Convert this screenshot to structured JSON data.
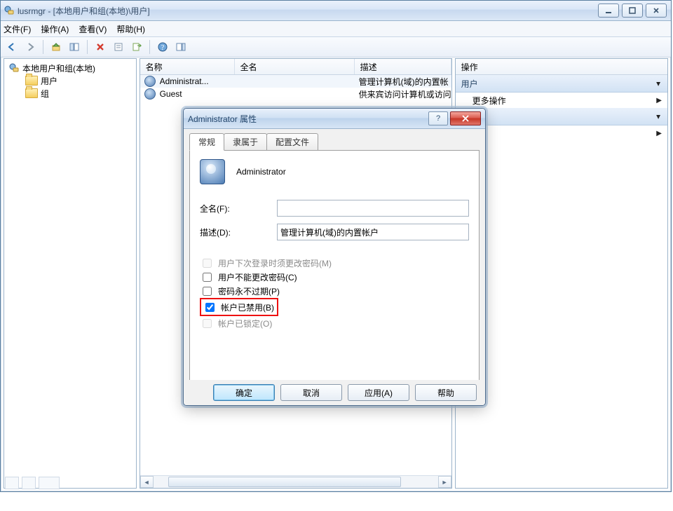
{
  "window": {
    "title": "lusrmgr - [本地用户和组(本地)\\用户]"
  },
  "menubar": {
    "file": "文件(F)",
    "action": "操作(A)",
    "view": "查看(V)",
    "help": "帮助(H)"
  },
  "tree": {
    "root": "本地用户和组(本地)",
    "users": "用户",
    "groups": "组"
  },
  "list": {
    "headers": {
      "name": "名称",
      "fullname": "全名",
      "desc": "描述"
    },
    "rows": [
      {
        "name": "Administrat...",
        "fullname": "",
        "desc": "管理计算机(域)的内置帐"
      },
      {
        "name": "Guest",
        "fullname": "",
        "desc": "供来宾访问计算机或访问"
      }
    ]
  },
  "actions": {
    "header": "操作",
    "section_user": "用户",
    "more": "更多操作",
    "section_blank": ""
  },
  "dialog": {
    "title": "Administrator 属性",
    "tabs": {
      "general": "常规",
      "memberof": "隶属于",
      "profile": "配置文件"
    },
    "account_name": "Administrator",
    "labels": {
      "fullname": "全名(F):",
      "desc": "描述(D):"
    },
    "values": {
      "fullname": "",
      "desc": "管理计算机(域)的内置帐户"
    },
    "checks": {
      "must_change": "用户下次登录时须更改密码(M)",
      "cannot_change": "用户不能更改密码(C)",
      "never_expire": "密码永不过期(P)",
      "disabled": "帐户已禁用(B)",
      "locked": "帐户已锁定(O)"
    },
    "buttons": {
      "ok": "确定",
      "cancel": "取消",
      "apply": "应用(A)",
      "help": "帮助"
    }
  }
}
